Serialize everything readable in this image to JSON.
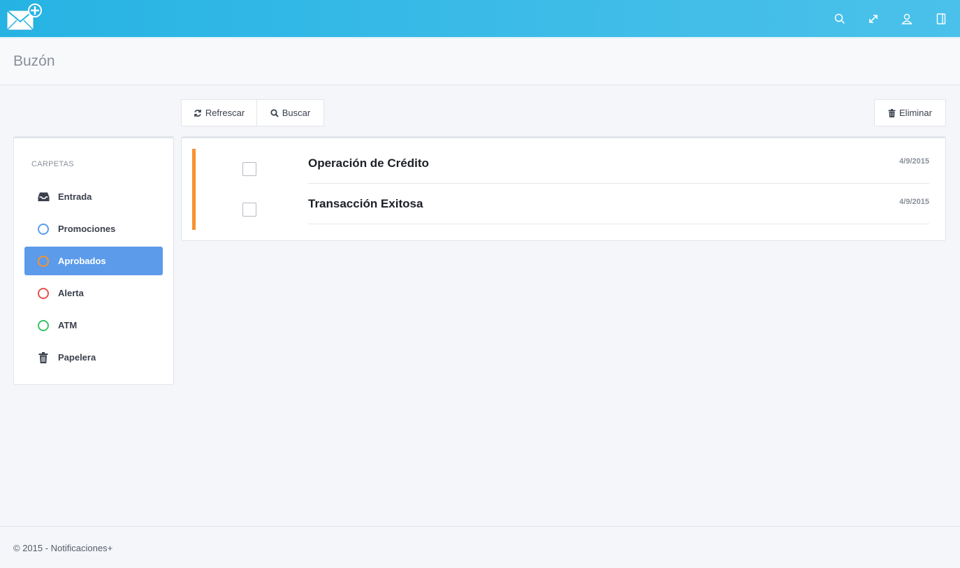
{
  "app": {
    "logo_icon": "envelope-plus-icon",
    "top_icons": [
      "search-icon",
      "expand-icon",
      "user-icon",
      "panel-icon"
    ]
  },
  "page": {
    "title": "Buzón"
  },
  "toolbar": {
    "refresh_label": "Refrescar",
    "search_label": "Buscar",
    "delete_label": "Eliminar"
  },
  "sidebar": {
    "heading": "CARPETAS",
    "items": [
      {
        "label": "Entrada",
        "icon": "inbox-icon",
        "color": "#3a404c"
      },
      {
        "label": "Promociones",
        "icon": "circle-blue-icon",
        "color": "#5a9cf0"
      },
      {
        "label": "Aprobados",
        "icon": "circle-orange-icon",
        "color": "#f6922f",
        "active": true
      },
      {
        "label": "Alerta",
        "icon": "circle-red-icon",
        "color": "#e5534b"
      },
      {
        "label": "ATM",
        "icon": "circle-green-icon",
        "color": "#3cc068"
      },
      {
        "label": "Papelera",
        "icon": "trash-icon",
        "color": "#3a404c"
      }
    ]
  },
  "mails": [
    {
      "subject": "Operación de Crédito",
      "date": "4/9/2015"
    },
    {
      "subject": "Transacción Exitosa",
      "date": "4/9/2015"
    }
  ],
  "footer": {
    "text": "© 2015 - Notificaciones+"
  },
  "colors": {
    "topbar": "#26b3e3",
    "accent_bar": "#f6922f",
    "active_folder": "#5b9bea"
  }
}
